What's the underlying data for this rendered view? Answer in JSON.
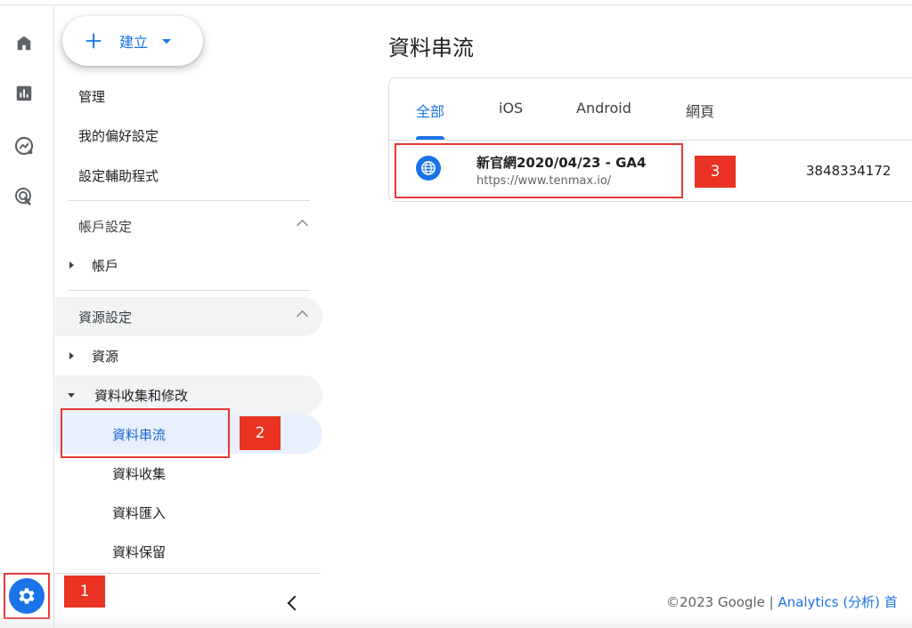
{
  "rail": {
    "icons": [
      "home-icon",
      "reports-icon",
      "explore-icon",
      "advertising-icon"
    ],
    "settings_icon": "gear-icon"
  },
  "nav": {
    "create_label": "建立",
    "items": [
      "管理",
      "我的偏好設定",
      "設定輔助程式"
    ],
    "account_section": {
      "title": "帳戶設定",
      "tree": "帳戶"
    },
    "property_section": {
      "title": "資源設定",
      "tree_property": "資源",
      "tree_data": "資料收集和修改",
      "sub_items": [
        "資料串流",
        "資料收集",
        "資料匯入",
        "資料保留"
      ]
    }
  },
  "main": {
    "title": "資料串流",
    "tabs": [
      "全部",
      "iOS",
      "Android",
      "網頁"
    ],
    "stream": {
      "name": "新官網2020/04/23 - GA4",
      "url": "https://www.tenmax.io/",
      "id": "3848334172"
    },
    "footer_prefix": "©2023 Google | ",
    "footer_link": "Analytics (分析) 首"
  },
  "annotations": {
    "one": "1",
    "two": "2",
    "three": "3"
  },
  "colors": {
    "accent": "#1a73e8",
    "highlight": "#e53935",
    "badge": "#ea3323",
    "active_bg": "#e8f0fe"
  }
}
